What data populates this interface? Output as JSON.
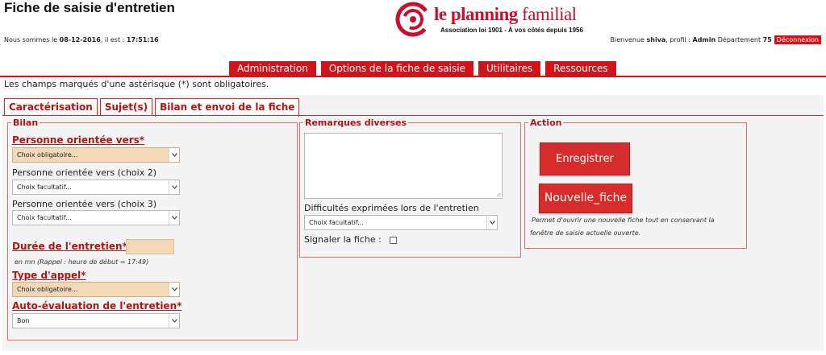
{
  "header": {
    "title": "Fiche de saisie d'entretien",
    "date_prefix": "Nous sommes le ",
    "date": "08-12-2016",
    "time_prefix": ", il est : ",
    "time": "17:51:16",
    "brand_bold": "le planning",
    "brand_light": " familial",
    "tagline": "Association loi 1901 - À vos côtés depuis 1956",
    "welcome_prefix": "Bienvenue ",
    "user": "shiva",
    "profile_prefix": ", profil : ",
    "profile": "Admin",
    "dept_prefix": " Département ",
    "dept": "75",
    "logout": "Déconnexion"
  },
  "nav": {
    "items": [
      "Administration",
      "Options de la fiche de saisie",
      "Utilitaires",
      "Ressources"
    ]
  },
  "notice": "Les champs marqués d'une astérisque (*) sont obligatoires.",
  "tabs": [
    "Caractérisation",
    "Sujet(s)",
    "Bilan et envoi de la fiche"
  ],
  "bilan": {
    "legend": "Bilan",
    "orientee_label": "Personne orientée vers*",
    "orientee_value": "Choix obligatoire...",
    "orientee2_label": "Personne orientée vers (choix 2)",
    "orientee2_value": "Choix facultatif...",
    "orientee3_label": "Personne orientée vers (choix 3)",
    "orientee3_value": "Choix facultatif...",
    "duree_label": "Durée de l'entretien*",
    "duree_hint": "en mn (Rappel : heure de début = 17:49)",
    "type_label": "Type d'appel*",
    "type_value": "Choix obligatoire...",
    "auto_label": "Auto-évaluation de l'entretien*",
    "auto_value": "Bon"
  },
  "remarques": {
    "legend": "Remarques diverses",
    "difficultes_label": "Difficultés exprimées lors de l'entretien",
    "difficultes_value": "Choix facultatif...",
    "signaler_label": "Signaler la fiche :"
  },
  "action": {
    "legend": "Action",
    "save": "Enregistrer",
    "new": "Nouvelle_fiche",
    "hint_line1": "Permet d'ouvrir une nouvelle fiche tout en conservant la",
    "hint_line2": "fenêtre de saisie actuelle ouverte."
  },
  "colors": {
    "brand_red": "#d0141b",
    "required_field": "#f3d8b6",
    "panel_bg": "#f4f4f4"
  }
}
